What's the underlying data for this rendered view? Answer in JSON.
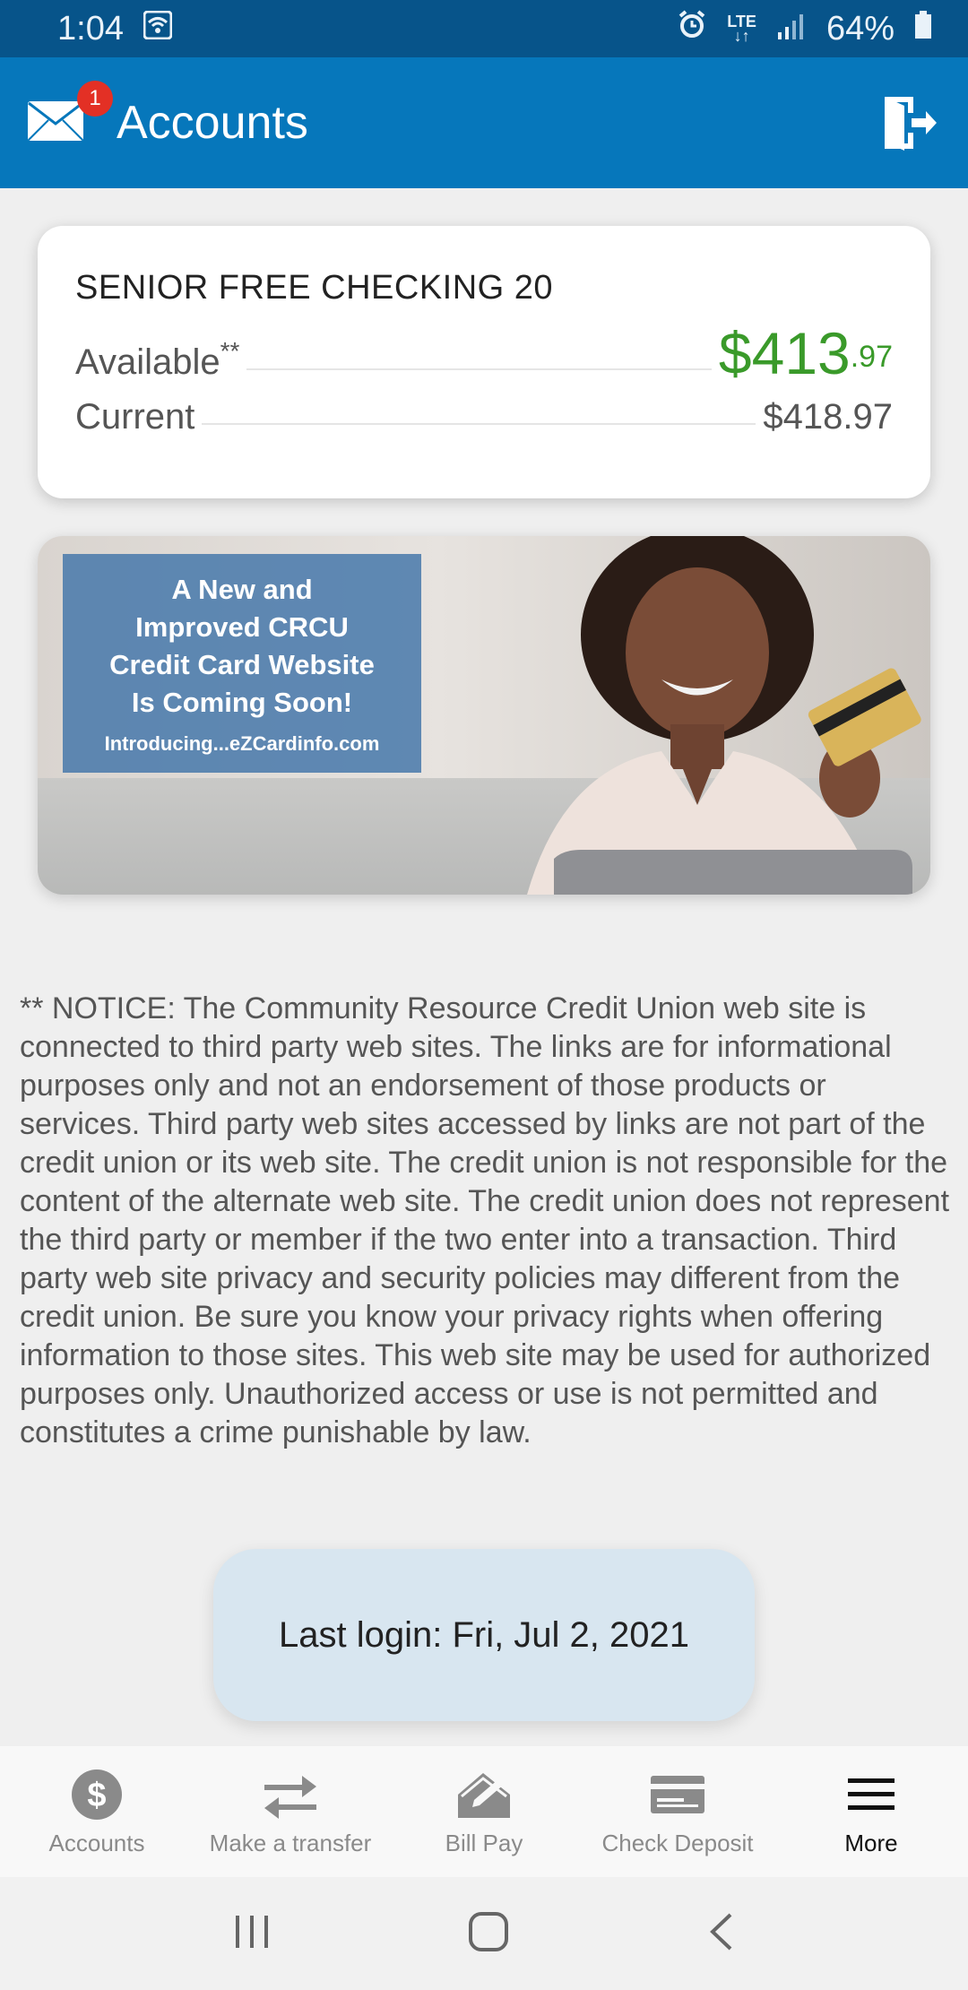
{
  "status_bar": {
    "time": "1:04",
    "lte": "LTE",
    "battery": "64%"
  },
  "app_bar": {
    "title": "Accounts",
    "mail_badge": "1"
  },
  "account": {
    "name": "SENIOR FREE CHECKING 20",
    "available_label": "Available",
    "available_marker": "**",
    "available_dollars": "$413",
    "available_cents": ".97",
    "current_label": "Current",
    "current_value": "$418.97"
  },
  "banner": {
    "headline": "A New and\nImproved CRCU\nCredit Card Website\nIs Coming Soon!",
    "subline": "Introducing...eZCardinfo.com"
  },
  "notice": {
    "text": "** NOTICE: The Community Resource Credit Union web site is connected to third party web sites. The links are for informational purposes only and not an endorsement of those products or services. Third party web sites accessed by links are not part of the credit union or its web site. The credit union is not responsible for the content of the alternate web site. The credit union does not represent the third party or member if the two enter into a transaction. Third party web site privacy and security policies may different from the credit union. Be sure you know your privacy rights when offering information to those sites. This web site may be used for authorized purposes only. Unauthorized access or use is not permitted and constitutes a crime punishable by law."
  },
  "toast": {
    "text": "Last login: Fri, Jul 2, 2021"
  },
  "bottom_nav": {
    "items": [
      {
        "label": "Accounts",
        "icon": "dollar-circle-icon"
      },
      {
        "label": "Make a transfer",
        "icon": "transfer-arrows-icon"
      },
      {
        "label": "Bill Pay",
        "icon": "envelope-pen-icon"
      },
      {
        "label": "Check Deposit",
        "icon": "check-icon"
      },
      {
        "label": "More",
        "icon": "hamburger-menu-icon"
      }
    ],
    "active_index": 4
  },
  "colors": {
    "status_bar": "#07548a",
    "app_bar": "#0677bb",
    "available_green": "#3a9a2a",
    "toast_bg": "#d8e6f0",
    "badge_red": "#e33025"
  }
}
